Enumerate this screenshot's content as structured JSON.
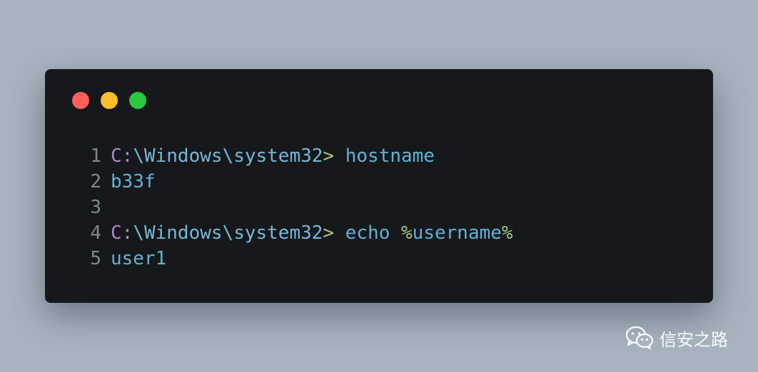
{
  "window": {
    "controls": {
      "close_color": "#fe5f57",
      "minimize_color": "#febc2e",
      "maximize_color": "#28c840"
    }
  },
  "code": {
    "lines": [
      {
        "number": "1",
        "tokens": [
          {
            "type": "path",
            "text": "C:"
          },
          {
            "type": "sep",
            "text": "\\Windows\\system32"
          },
          {
            "type": "prompt",
            "text": ">"
          },
          {
            "type": "space",
            "text": " "
          },
          {
            "type": "cmd",
            "text": "hostname"
          }
        ]
      },
      {
        "number": "2",
        "tokens": [
          {
            "type": "out",
            "text": "b33f"
          }
        ]
      },
      {
        "number": "3",
        "tokens": []
      },
      {
        "number": "4",
        "tokens": [
          {
            "type": "path",
            "text": "C:"
          },
          {
            "type": "sep",
            "text": "\\Windows\\system32"
          },
          {
            "type": "prompt",
            "text": ">"
          },
          {
            "type": "space",
            "text": " "
          },
          {
            "type": "cmd",
            "text": "echo"
          },
          {
            "type": "space",
            "text": " "
          },
          {
            "type": "var",
            "text": "%"
          },
          {
            "type": "cmd",
            "text": "username"
          },
          {
            "type": "var",
            "text": "%"
          }
        ]
      },
      {
        "number": "5",
        "tokens": [
          {
            "type": "out",
            "text": "user1"
          }
        ]
      }
    ]
  },
  "watermark": {
    "icon": "wechat-icon",
    "text": "信安之路"
  }
}
